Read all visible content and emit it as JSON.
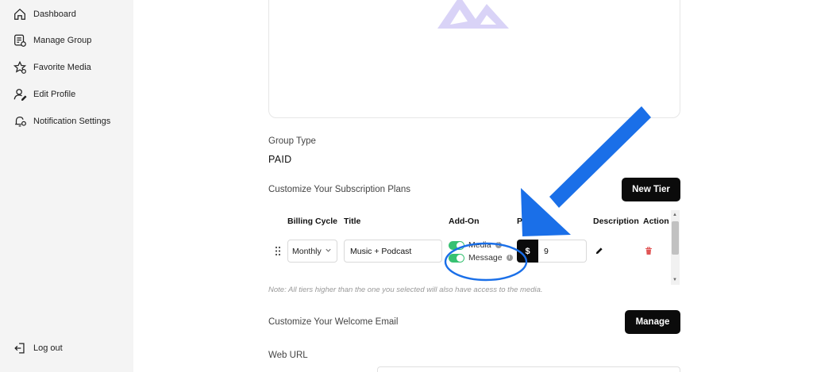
{
  "sidebar": {
    "items": [
      {
        "label": "Dashboard",
        "icon": "home-icon"
      },
      {
        "label": "Manage Group",
        "icon": "group-list-icon"
      },
      {
        "label": "Favorite Media",
        "icon": "star-icon"
      },
      {
        "label": "Edit Profile",
        "icon": "user-edit-icon"
      },
      {
        "label": "Notification Settings",
        "icon": "bell-settings-icon"
      }
    ],
    "logout": {
      "label": "Log out",
      "icon": "logout-icon"
    }
  },
  "group": {
    "type_label": "Group Type",
    "type_value": "PAID"
  },
  "subscriptions": {
    "heading": "Customize Your Subscription Plans",
    "new_tier_label": "New Tier",
    "columns": [
      "Billing Cycle",
      "Title",
      "Add-On",
      "P",
      "Description",
      "Action"
    ],
    "row": {
      "billing_cycle": "Monthly",
      "title": "Music + Podcast",
      "addons": [
        {
          "label": "Media",
          "enabled": true
        },
        {
          "label": "Message",
          "enabled": true
        }
      ],
      "currency_symbol": "$",
      "price": "9"
    },
    "note": "Note: All tiers higher than the one you selected will also have access to the media."
  },
  "welcome_email": {
    "label": "Customize Your Welcome Email",
    "manage_label": "Manage"
  },
  "web_url": {
    "label": "Web URL"
  },
  "colors": {
    "accent_logo": "#d9d3f7",
    "annotation_blue": "#1a6fe8",
    "toggle_green": "#38c172",
    "delete_red": "#e05555"
  }
}
